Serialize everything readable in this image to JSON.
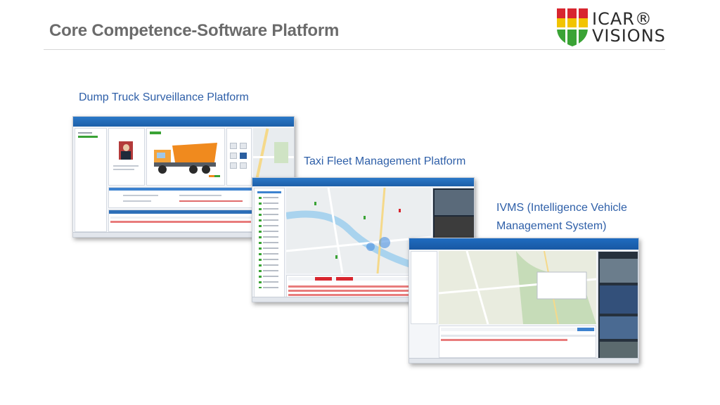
{
  "header": {
    "title": "Core Competence-Software Platform",
    "logo_line1": "ICAR®",
    "logo_line2": "VISIONS"
  },
  "platforms": [
    {
      "caption": "Dump Truck Surveillance Platform"
    },
    {
      "caption": "Taxi Fleet Management Platform"
    },
    {
      "caption_line1": "IVMS (Intelligence Vehicle",
      "caption_line2": "Management System)"
    }
  ],
  "colors": {
    "title": "#6b6b6b",
    "caption": "#2e5fa8",
    "logo_red": "#d8262f",
    "logo_yellow": "#f2c400",
    "logo_green": "#3aa335",
    "app_blue": "#2b78c7",
    "truck_orange": "#f08a1e"
  }
}
